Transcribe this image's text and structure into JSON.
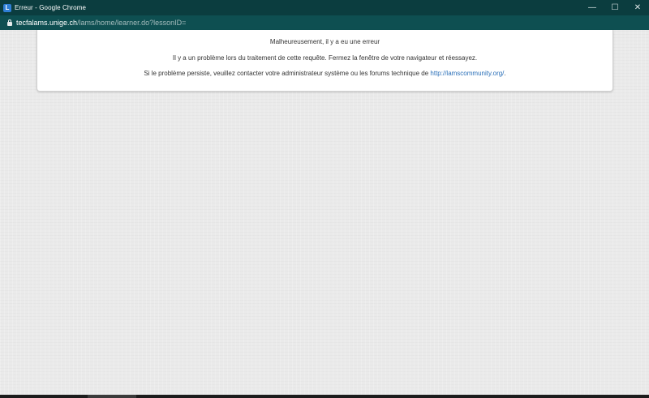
{
  "window": {
    "app_icon_letter": "L",
    "title": "Erreur - Google Chrome",
    "minimize_glyph": "—",
    "maximize_glyph": "☐",
    "close_glyph": "✕"
  },
  "address": {
    "host": "tecfalams.unige.ch",
    "path": "/lams/home/learner.do?lessonID="
  },
  "error": {
    "heading": "Malheureusement, il y a eu une erreur",
    "message": "Il y a un problème lors du traitement de cette requête. Fermez la fenêtre de votre navigateur et réessayez.",
    "contact_prefix": "Si le problème persiste, veuillez contacter votre administrateur système ou les forums technique de ",
    "link_text": "http://lamscommunity.org/",
    "contact_suffix": "."
  },
  "colors": {
    "titlebar": "#0b3d3f",
    "addressbar": "#0e4f51",
    "link": "#2a6fb8",
    "background": "#eaeaea"
  }
}
